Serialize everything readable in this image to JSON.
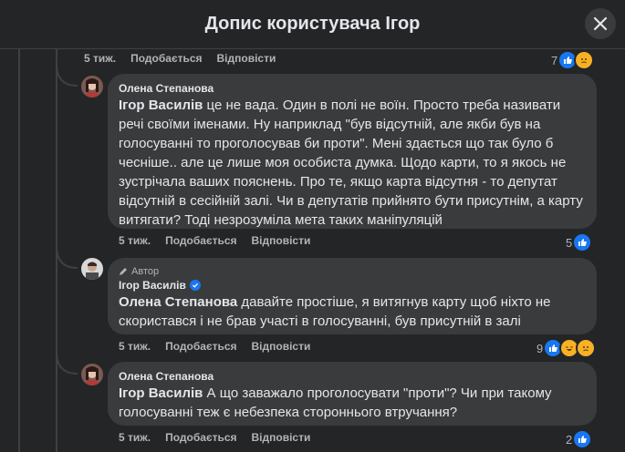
{
  "header": {
    "title": "Допис користувача Ігор"
  },
  "icons": {
    "close": "close-icon",
    "like": "thumbs-up-icon",
    "sad": "sad-face-icon",
    "haha": "laughing-face-icon",
    "verified": "verified-badge-icon",
    "author": "pencil-icon"
  },
  "colors": {
    "background": "#242526",
    "bubble": "#3a3b3c",
    "accent": "#1877f2",
    "muted": "#b0b3b8"
  },
  "top_comment": {
    "time": "5 тиж.",
    "like_label": "Подобається",
    "reply_label": "Відповісти",
    "reaction_count": "7"
  },
  "comments": [
    {
      "author": "Олена Степанова",
      "mention": "Ігор Василів",
      "text": " це не вада. Один в полі не воїн. Просто треба називати речі своїми іменами. Ну наприклад \"був відсутній, але якби був на голосуванні то проголосував би проти\". Мені здається що так було б чесніше.. але це лише моя особиста думка. Щодо карти, то я якось не зустрічала ваших пояснень. Про те, якщо карта відсутня - то депутат відсутній в сесійній залі. Чи в депутатів прийнято бути присутнім, а карту витягати? Тоді незрозуміла мета таких маніпуляцій",
      "time": "5 тиж.",
      "like_label": "Подобається",
      "reply_label": "Відповісти",
      "reaction_count": "5"
    },
    {
      "badge": "Автор",
      "author": "Ігор Василів",
      "mention": "Олена Степанова",
      "text": " давайте простіше, я витягнув карту щоб ніхто не скористався і не брав участі в голосуванні, був присутній в залі",
      "time": "5 тиж.",
      "like_label": "Подобається",
      "reply_label": "Відповісти",
      "reaction_count": "9"
    },
    {
      "author": "Олена Степанова",
      "mention": "Ігор Василів",
      "text": " А що заважало проголосувати \"проти\"? Чи при такому голосуванні теж є небезпека стороннього втручання?",
      "time": "5 тиж.",
      "like_label": "Подобається",
      "reply_label": "Відповісти",
      "reaction_count": "2"
    }
  ]
}
